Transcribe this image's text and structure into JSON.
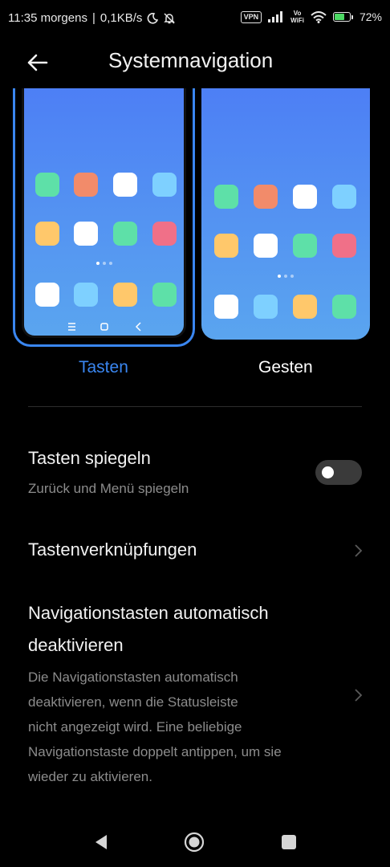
{
  "status_bar": {
    "time": "11:35 morgens",
    "speed": "0,1KB/s",
    "vpn": "VPN",
    "vowifi_top": "Vo",
    "vowifi_bottom": "WiFi",
    "battery_percent": "72",
    "battery_level": 0.72,
    "icons": [
      "moon-icon",
      "bell-off-icon",
      "signal-icon",
      "wifi-icon",
      "battery-charging-icon"
    ]
  },
  "header": {
    "title": "Systemnavigation",
    "back_icon": "arrow-left-icon"
  },
  "options": {
    "tasten_label": "Tasten",
    "gesten_label": "Gesten",
    "selected": "Tasten"
  },
  "settings": {
    "mirror_title": "Tasten spiegeln",
    "mirror_sub": "Zurück und Menü spiegeln",
    "mirror_enabled": false,
    "shortcuts_title": "Tastenverknüpfungen",
    "auto_title_line1": "Navigationstasten automatisch",
    "auto_title_line2": "deaktivieren",
    "auto_sub_lines": [
      "Die Navigationstasten automatisch",
      "deaktivieren, wenn die Statusleiste",
      "nicht angezeigt wird. Eine beliebige",
      "Navigationstaste doppelt antippen, um sie",
      "wieder zu aktivieren."
    ]
  },
  "colors": {
    "accent": "#3a86f0",
    "app_green": "#5ee0a8",
    "app_orange": "#f28b6a",
    "app_white": "#ffffff",
    "app_lightblue": "#7ed0ff",
    "app_yellow": "#ffc86b",
    "app_pink": "#f07088"
  }
}
